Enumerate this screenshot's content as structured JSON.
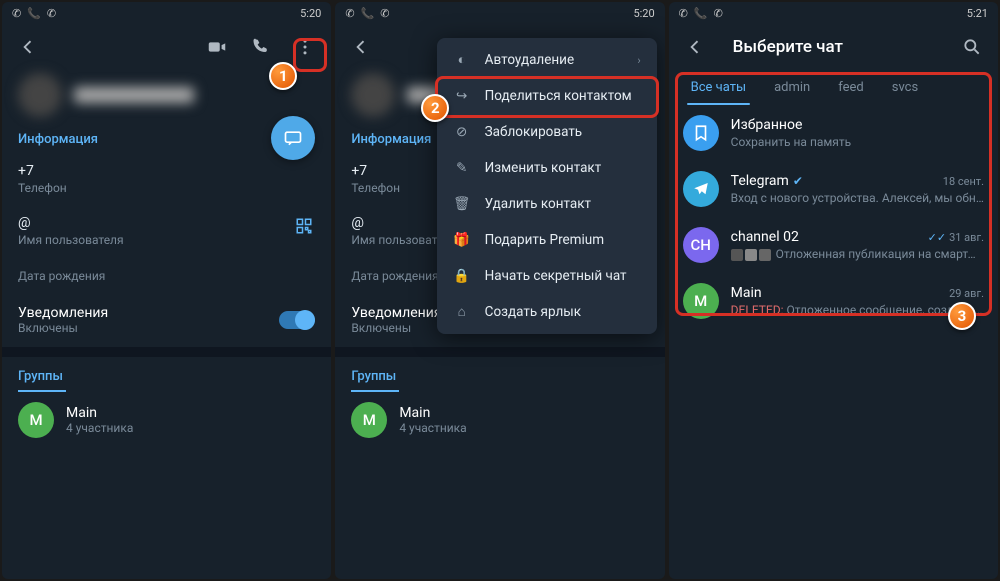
{
  "statusbar": {
    "time1": "5:20",
    "time2": "5:20",
    "time3": "5:21"
  },
  "profile": {
    "info_label": "Информация",
    "phone_value": "+7",
    "phone_label": "Телефон",
    "username_value": "@",
    "username_label": "Имя пользователя",
    "birthday_label": "Дата рождения",
    "notif_label": "Уведомления",
    "notif_state": "Включены",
    "groups_label": "Группы",
    "group_name": "Main",
    "group_members": "4 участника"
  },
  "menu": {
    "autodelete": "Автоудаление",
    "share": "Поделиться контактом",
    "block": "Заблокировать",
    "edit": "Изменить контакт",
    "delete": "Удалить контакт",
    "gift": "Подарить Premium",
    "secret": "Начать секретный чат",
    "shortcut": "Создать ярлык"
  },
  "picker": {
    "title": "Выберите чат",
    "tabs": {
      "all": "Все чаты",
      "t2": "admin",
      "t3": "feed",
      "t4": "svcs"
    },
    "chats": {
      "saved": {
        "name": "Избранное",
        "preview": "Сохранить на память"
      },
      "tg": {
        "name": "Telegram",
        "date": "18 сент.",
        "preview": "Вход с нового устройства. Алексей, мы обна..."
      },
      "ch": {
        "name": "channel 02",
        "date": "31 авг.",
        "preview": "Отложенная публикация на смартфо..."
      },
      "main": {
        "name": "Main",
        "date": "29 авг.",
        "preview_prefix": "DELETED:",
        "preview_rest": " Отложенное сообщение, созданное..."
      }
    }
  }
}
